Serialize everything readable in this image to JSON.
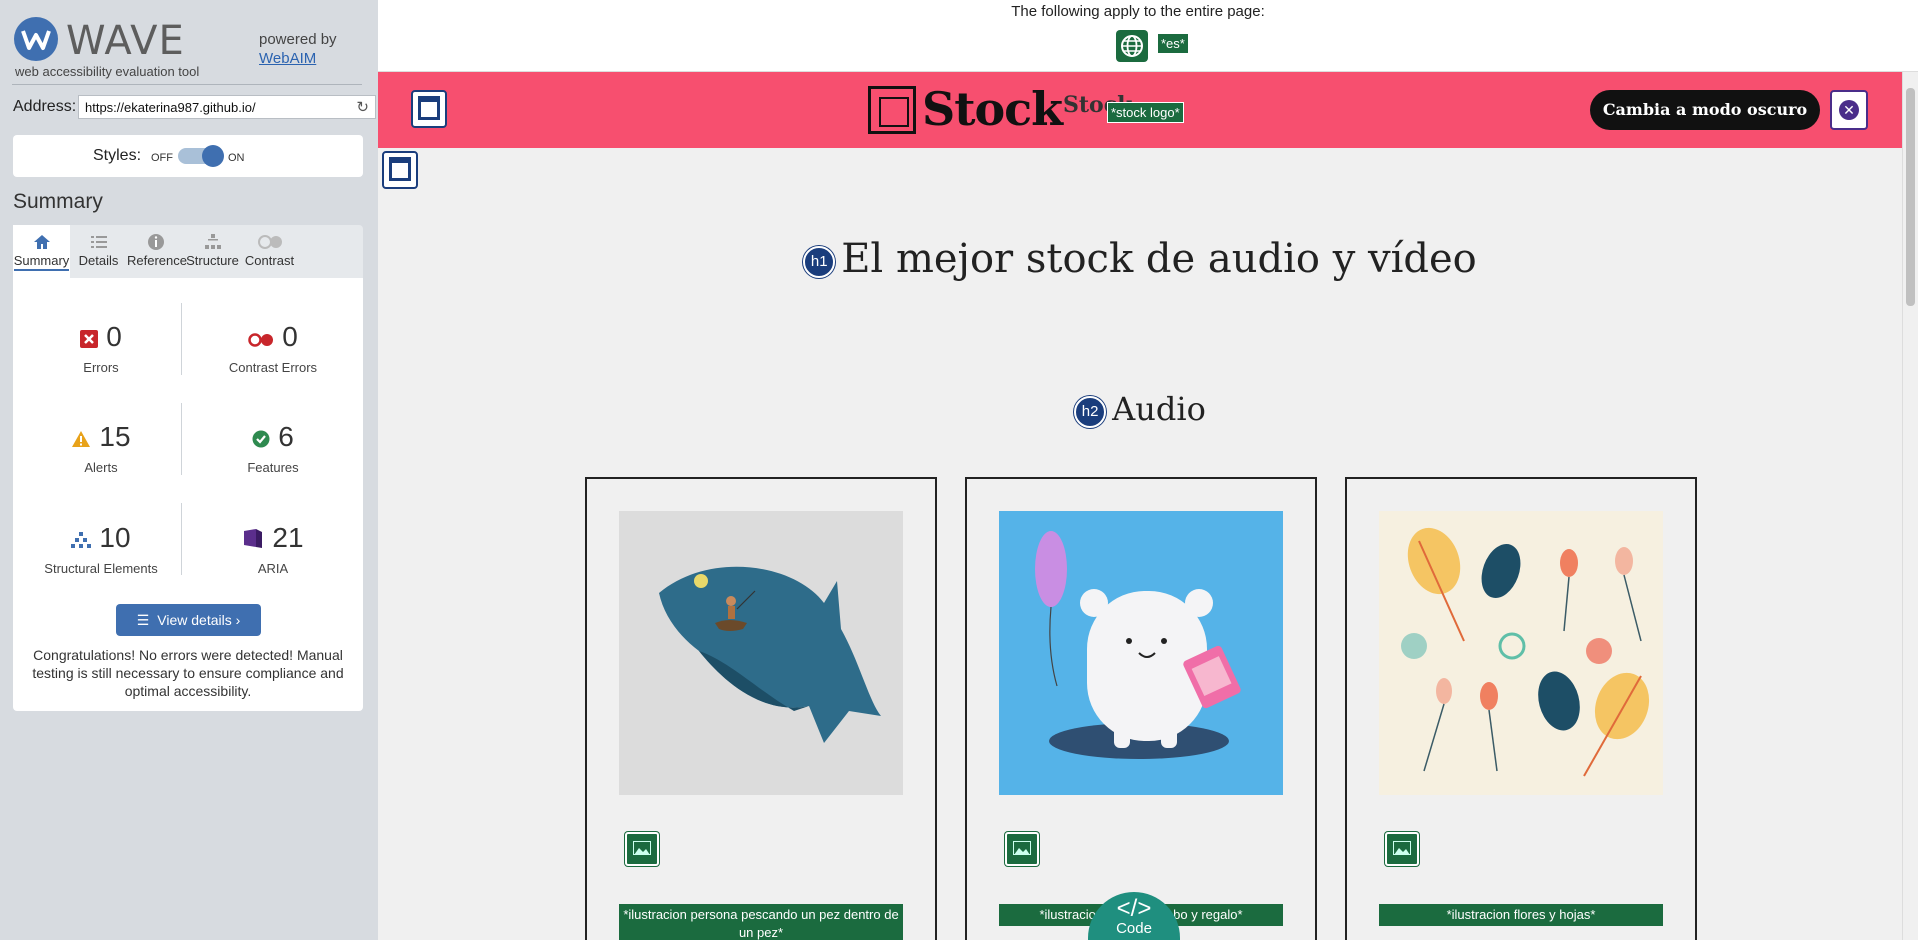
{
  "wave": {
    "logo_text": "WAVE",
    "tagline": "web accessibility evaluation tool",
    "powered_by": "powered by",
    "webaim_link": "WebAIM",
    "address_label": "Address:",
    "address_value": "https://ekaterina987.github.io/",
    "styles_label": "Styles:",
    "styles_off": "OFF",
    "styles_on": "ON",
    "summary_heading": "Summary",
    "tabs": [
      {
        "label": "Summary",
        "icon": "home-icon"
      },
      {
        "label": "Details",
        "icon": "list-icon"
      },
      {
        "label": "Reference",
        "icon": "info-icon"
      },
      {
        "label": "Structure",
        "icon": "structure-icon"
      },
      {
        "label": "Contrast",
        "icon": "contrast-icon"
      }
    ],
    "stats": {
      "errors": {
        "count": "0",
        "label": "Errors"
      },
      "contrast_errors": {
        "count": "0",
        "label": "Contrast Errors"
      },
      "alerts": {
        "count": "15",
        "label": "Alerts"
      },
      "features": {
        "count": "6",
        "label": "Features"
      },
      "structural": {
        "count": "10",
        "label": "Structural Elements"
      },
      "aria": {
        "count": "21",
        "label": "ARIA"
      }
    },
    "view_details": "View details ›",
    "congrats": "Congratulations! No errors were detected! Manual testing is still necessary to ensure compliance and optimal accessibility."
  },
  "page": {
    "entire_page_text": "The following apply to the entire page:",
    "lang_tag": "*es*",
    "brand": "Stock",
    "brand_small": "Stock",
    "logo_alt": "*stock logo*",
    "dark_mode_button": "Cambia a modo oscuro",
    "h1_badge": "h1",
    "h1": "El mejor stock de audio y vídeo",
    "h2_badge": "h2",
    "h2": "Audio",
    "cards": [
      {
        "alt": "*ilustracion persona pescando un pez dentro de un pez*"
      },
      {
        "alt": "*ilustracion oso con globo y regalo*"
      },
      {
        "alt": "*ilustracion flores y hojas*"
      }
    ],
    "code_button": "Code",
    "code_symbol": "</>"
  },
  "colors": {
    "wave_blue": "#3f6fb0",
    "header_pink": "#f74f6f",
    "alt_green": "#1b6b3f",
    "heading_badge": "#1a3d7c",
    "code_teal": "#1f8f7f"
  }
}
